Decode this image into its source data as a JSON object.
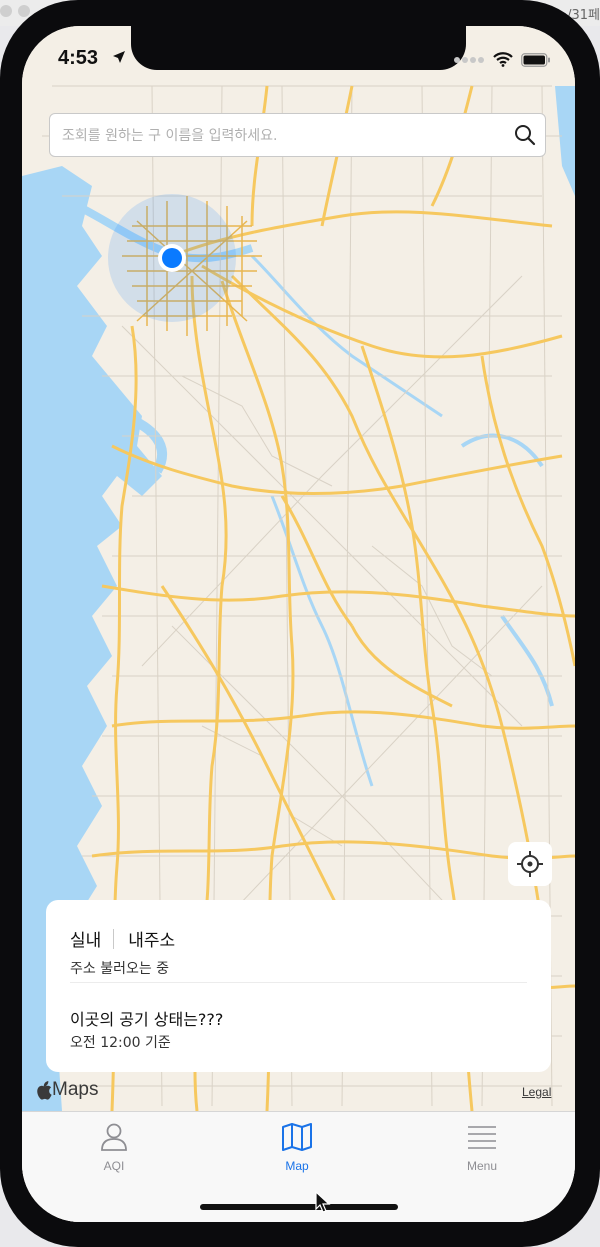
{
  "window": {
    "partial_tab_text": "/31페"
  },
  "status_bar": {
    "time": "4:53"
  },
  "search": {
    "placeholder": "조회를 원하는 구 이름을 입력하세요."
  },
  "info_card": {
    "indoor_label": "실내",
    "my_address_label": "내주소",
    "address_status": "주소 불러오는 중",
    "air_question": "이곳의 공기 상태는???",
    "time_basis": "오전 12:00 기준"
  },
  "map": {
    "attribution": "Maps",
    "legal": "Legal"
  },
  "tabs": [
    {
      "label": "AQI",
      "icon": "person-icon",
      "active": false
    },
    {
      "label": "Map",
      "icon": "map-icon",
      "active": true
    },
    {
      "label": "Menu",
      "icon": "menu-icon",
      "active": false
    }
  ],
  "colors": {
    "accent": "#1a73e8",
    "inactive": "#8e8e93",
    "land": "#f4efe6",
    "water": "#a8d6f5",
    "road": "#f6c85f",
    "user_location": "#0a7aff"
  }
}
